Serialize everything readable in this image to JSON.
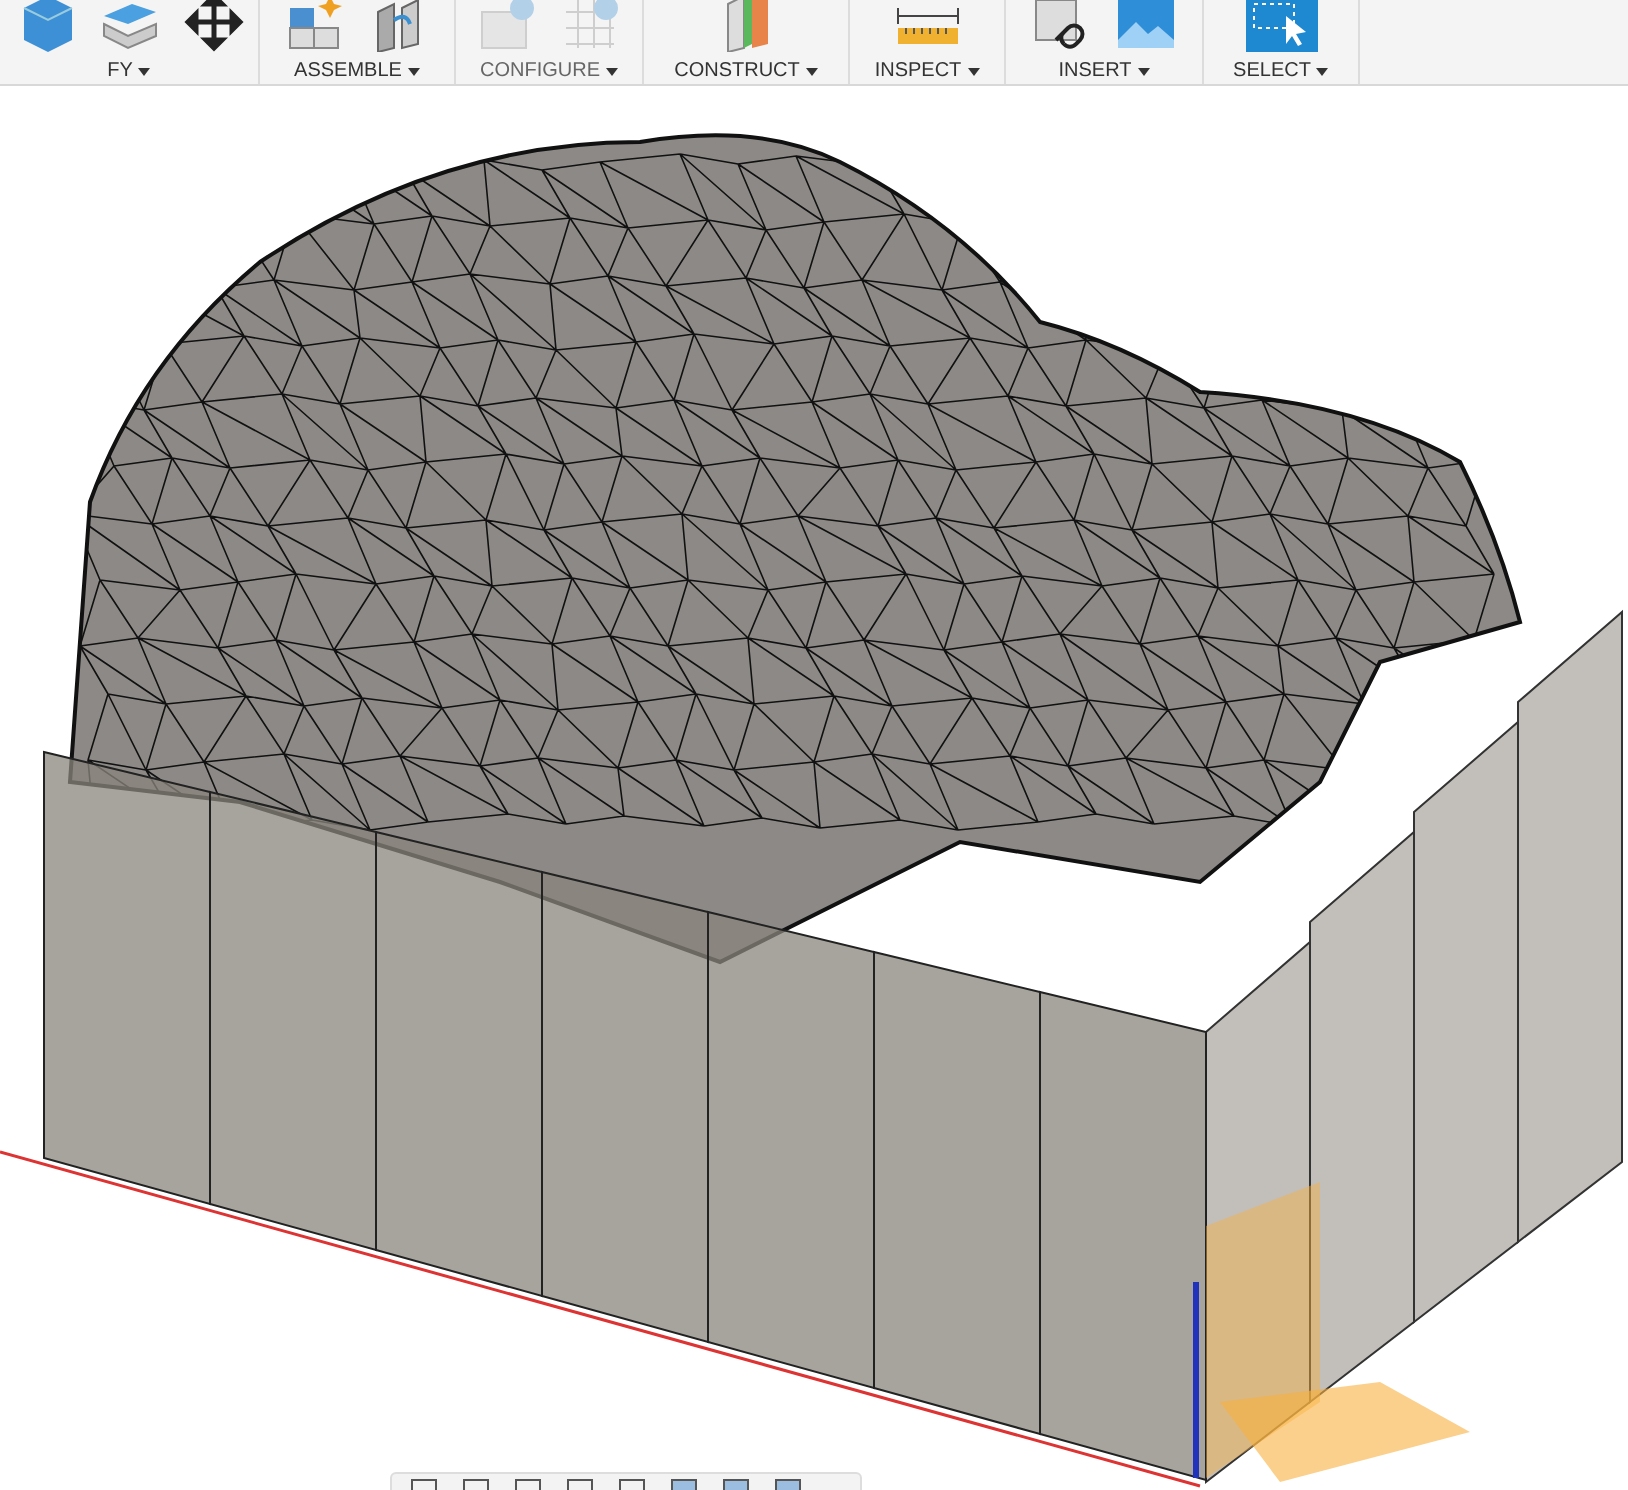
{
  "toolbar": {
    "groups": [
      {
        "label": "FY",
        "disabled": false
      },
      {
        "label": "ASSEMBLE",
        "disabled": false
      },
      {
        "label": "CONFIGURE",
        "disabled": true
      },
      {
        "label": "CONSTRUCT",
        "disabled": false
      },
      {
        "label": "INSPECT",
        "disabled": false
      },
      {
        "label": "INSERT",
        "disabled": false
      },
      {
        "label": "SELECT",
        "disabled": false
      }
    ]
  }
}
